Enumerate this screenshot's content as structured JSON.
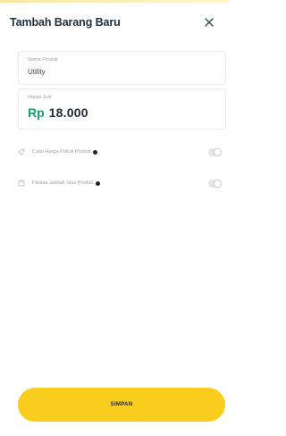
{
  "header": {
    "title": "Tambah Barang Baru"
  },
  "form": {
    "name_label": "Nama Produk",
    "name_value": "Utility",
    "price_label": "Harga Jual",
    "price_prefix": "Rp",
    "price_value": "18.000"
  },
  "options": [
    {
      "label": "Catat Harga Pokok Produk",
      "icon": "tag-icon",
      "enabled": false
    },
    {
      "label": "Pantau Jumlah Stok Produk",
      "icon": "box-icon",
      "enabled": false
    }
  ],
  "footer": {
    "save_label": "SIMPAN"
  },
  "colors": {
    "accent": "#f9cd1d",
    "price_prefix": "#17a06a",
    "text_dark": "#1f2a36"
  }
}
